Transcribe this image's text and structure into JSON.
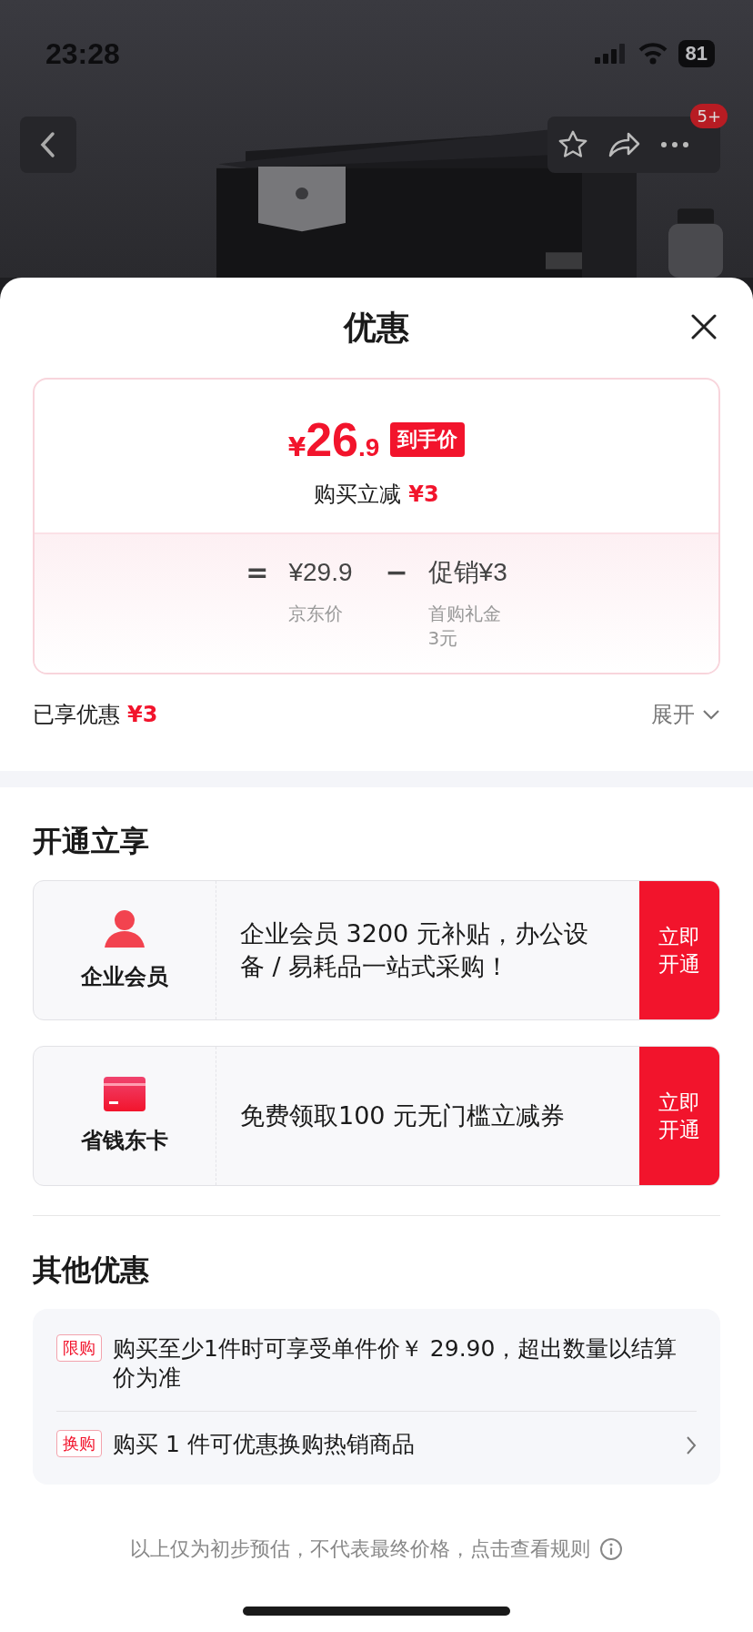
{
  "status_bar": {
    "time": "23:28",
    "battery": "81"
  },
  "nav": {
    "badge": "5+"
  },
  "sheet": {
    "title": "优惠",
    "price_card": {
      "currency": "¥",
      "price_int": "26",
      "price_dec": ".9",
      "tag": "到手价",
      "subtitle": "购买立减",
      "subtitle_amount": "¥3",
      "formula": [
        {
          "kind": "operator",
          "symbol": "="
        },
        {
          "kind": "term",
          "value": "¥29.9",
          "caption": "京东价"
        },
        {
          "kind": "operator",
          "symbol": "−"
        },
        {
          "kind": "term",
          "value": "促销¥3",
          "caption": "首购礼金3元"
        }
      ]
    },
    "enjoyed": {
      "label": "已享优惠",
      "amount": "¥3"
    },
    "expand": "展开"
  },
  "open_section": {
    "title": "开通立享",
    "offers": [
      {
        "kind": "member",
        "name": "企业会员",
        "description": "企业会员 3200 元补贴，办公设备 / 易耗品一站式采购！",
        "action": "立即开通"
      },
      {
        "kind": "card",
        "name": "省钱东卡",
        "description": "免费领取100 元无门槛立减券",
        "action": "立即开通"
      }
    ]
  },
  "other_section": {
    "title": "其他优惠",
    "items": [
      {
        "tag": "限购",
        "text": "购买至少1件时可享受单件价￥ 29.90，超出数量以结算价为准",
        "has_arrow": false
      },
      {
        "tag": "换购",
        "text": "购买 1 件可优惠换购热销商品",
        "has_arrow": true
      }
    ]
  },
  "footer": {
    "text": "以上仅为初步预估，不代表最终价格，点击查看规则"
  }
}
